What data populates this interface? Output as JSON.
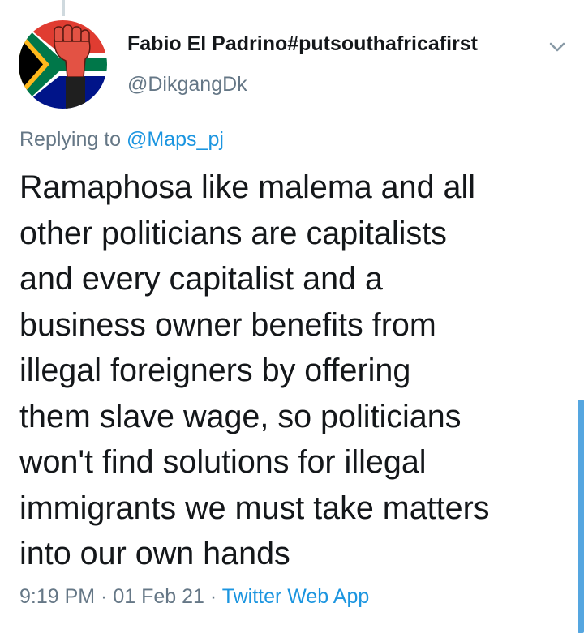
{
  "tweet": {
    "display_name": "Fabio El Padrino#putsouthafricafirst",
    "handle": "@DikgangDk",
    "replying_prefix": "Replying to",
    "replying_to": "@Maps_pj",
    "text_lines": [
      "Ramaphosa like malema and all",
      "other politicians are capitalists",
      "and every capitalist and a",
      "business owner benefits from",
      "illegal foreigners by offering",
      "them slave wage, so politicians",
      "won't find solutions for illegal",
      "immigrants we must take matters",
      "into our own hands"
    ],
    "time": "9:19 PM",
    "separator": " · ",
    "date": "01 Feb 21",
    "source": "Twitter Web App"
  },
  "icons": {
    "menu": "chevron-down-icon",
    "avatar": "south-africa-flag-fist-avatar"
  },
  "colors": {
    "link": "#1b95e0",
    "secondary_text": "#657786",
    "primary_text": "#14171a"
  }
}
